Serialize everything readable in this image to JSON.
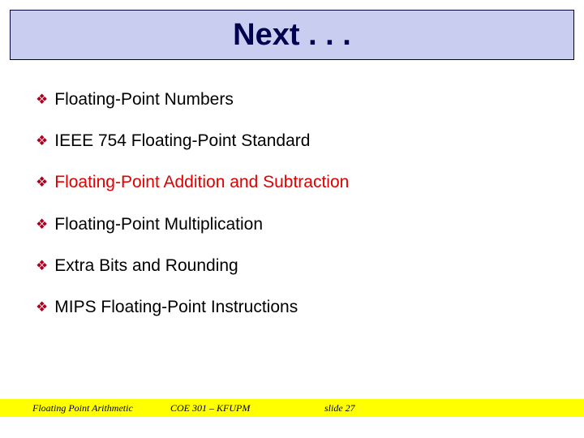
{
  "title": "Next . . .",
  "bullets": [
    {
      "text": "Floating-Point Numbers",
      "highlight": false
    },
    {
      "text": "IEEE 754 Floating-Point Standard",
      "highlight": false
    },
    {
      "text": "Floating-Point Addition and Subtraction",
      "highlight": true
    },
    {
      "text": "Floating-Point Multiplication",
      "highlight": false
    },
    {
      "text": "Extra Bits and Rounding",
      "highlight": false
    },
    {
      "text": "MIPS Floating-Point Instructions",
      "highlight": false
    }
  ],
  "footer": {
    "left": "Floating Point Arithmetic",
    "mid": "COE 301 – KFUPM",
    "right": "slide 27"
  },
  "bullet_glyph": "❖"
}
